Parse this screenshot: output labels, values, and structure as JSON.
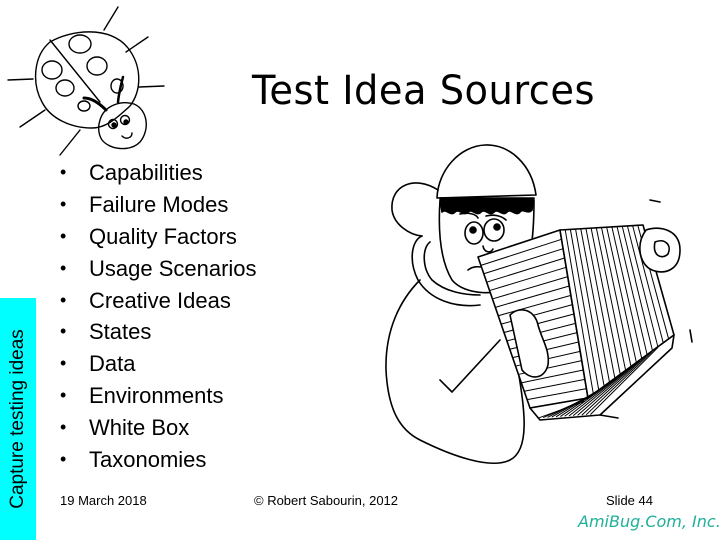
{
  "slide": {
    "title": "Test Idea Sources",
    "sidebar_label": "Capture testing ideas",
    "bullets": [
      "Capabilities",
      "Failure Modes",
      "Quality Factors",
      "Usage Scenarios",
      "Creative Ideas",
      "States",
      "Data",
      "Environments",
      "White Box",
      "Taxonomies"
    ],
    "bullet_glyph": "•",
    "footer": {
      "date": "19 March 2018",
      "copyright": "© Robert Sabourin, 2012",
      "slide_number": "Slide 44"
    },
    "logo_text": "AmiBug.Com, Inc.",
    "colors": {
      "sidebar": "#00ffff",
      "logo": "#1fb09a"
    },
    "illustrations": [
      "ladybug-illustration",
      "person-holding-box-illustration"
    ]
  }
}
